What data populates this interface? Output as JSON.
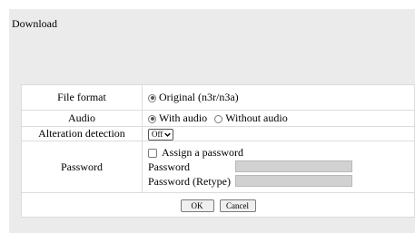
{
  "title": "Download",
  "rows": {
    "file_format": {
      "label": "File format",
      "option": "Original (n3r/n3a)"
    },
    "audio": {
      "label": "Audio",
      "option_with": "With audio",
      "option_without": "Without audio",
      "selected": "With audio"
    },
    "alteration": {
      "label": "Alteration detection",
      "selected": "Off"
    },
    "password": {
      "label": "Password",
      "assign_label": "Assign a password",
      "password_label": "Password",
      "retype_label": "Password (Retype)",
      "password_value": "",
      "retype_value": ""
    }
  },
  "buttons": {
    "ok": "OK",
    "cancel": "Cancel"
  },
  "colors": {
    "panel_bg": "#ebebeb",
    "field_disabled": "#d1d1d1"
  },
  "icons": {
    "select_chevron": "chevron-down-icon"
  }
}
